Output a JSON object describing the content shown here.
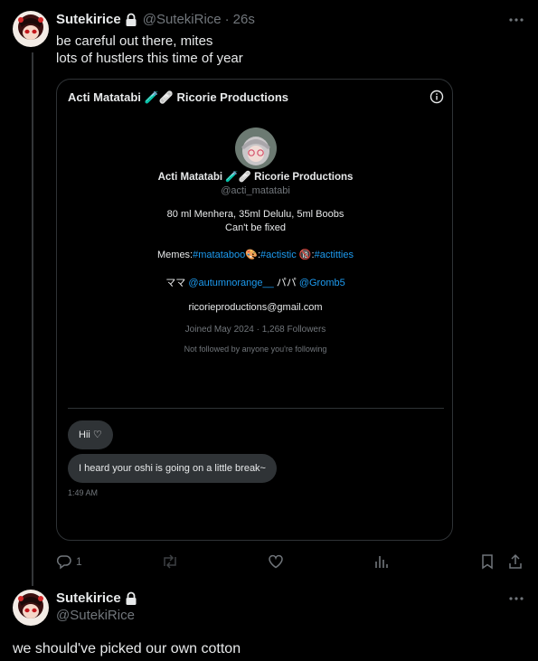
{
  "tweet1": {
    "display_name": "Sutekirice",
    "handle": "@SutekiRice",
    "time": "26s",
    "lines": [
      "be careful out there, mites",
      "lots of hustlers this time of year"
    ]
  },
  "card": {
    "title": "Acti Matatabi 🧪🩹 Ricorie Productions",
    "profile": {
      "name": "Acti Matatabi 🧪🩹 Ricorie Productions",
      "handle": "@acti_matatabi",
      "bio1": "80 ml Menhera, 35ml Delulu, 5ml Boobs",
      "bio2": "Can't be fixed",
      "memes_label": "Memes:",
      "memes_tag1": "#matataboo",
      "memes_emoji1": "🎨",
      "memes_colon": ":",
      "memes_tag2": "#actistic",
      "memes_emoji2": "🔞",
      "memes_colon2": ":",
      "memes_tag3": "#actitties",
      "mama_label": "ママ",
      "mama_handle": "@autumnorange__",
      "papa_label": "パパ",
      "papa_handle": "@Gromb5",
      "email": "ricorieproductions@gmail.com",
      "joined": "Joined May 2024 · 1,268 Followers",
      "not_followed": "Not followed by anyone you're following"
    },
    "messages": [
      "Hii ♡",
      "I heard your oshi is going on a little break~"
    ],
    "message_time": "1:49 AM"
  },
  "actions": {
    "reply_count": "1"
  },
  "tweet2": {
    "display_name": "Sutekirice",
    "handle": "@SutekiRice",
    "text": "we should've picked our own cotton"
  },
  "colors": {
    "background": "#000000",
    "text": "#e7e9ea",
    "muted": "#71767b",
    "link": "#1d9bf0",
    "border": "#2f3336"
  },
  "icons": [
    "lock-icon",
    "more-icon",
    "info-icon",
    "reply-icon",
    "retweet-icon",
    "like-icon",
    "views-icon",
    "bookmark-icon",
    "share-icon"
  ]
}
